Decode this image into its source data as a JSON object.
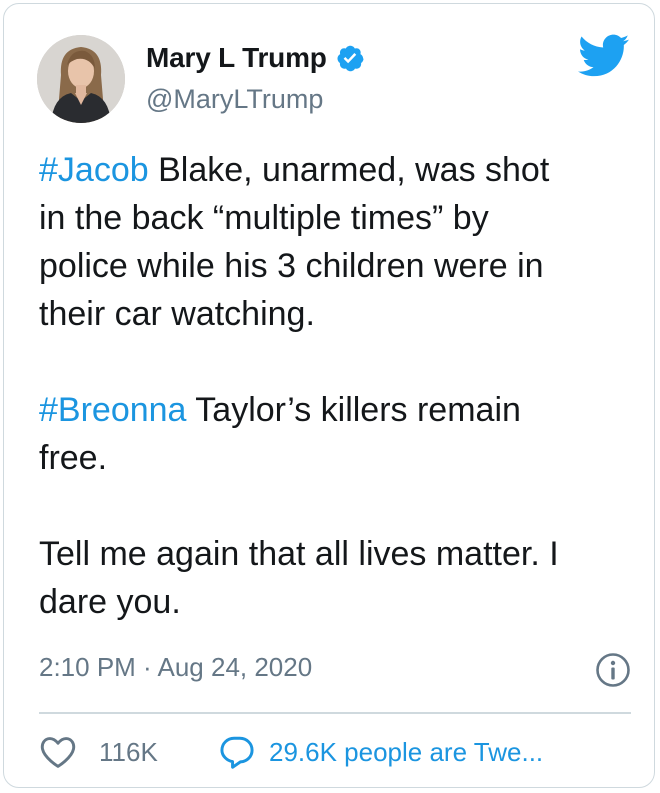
{
  "user": {
    "display_name": "Mary L Trump",
    "handle": "@MaryLTrump",
    "verified": true
  },
  "tweet": {
    "paragraphs": [
      {
        "lines": [
          [
            {
              "text": "#Jacob",
              "hashtag": true
            },
            {
              "text": " Blake, unarmed, was shot"
            }
          ],
          [
            {
              "text": "in the back “multiple times” by"
            }
          ],
          [
            {
              "text": "police while his 3 children were in"
            }
          ],
          [
            {
              "text": "their car watching."
            }
          ]
        ]
      },
      {
        "lines": [
          [
            {
              "text": "#Breonna",
              "hashtag": true
            },
            {
              "text": " Taylor’s killers remain"
            }
          ],
          [
            {
              "text": "free."
            }
          ]
        ]
      },
      {
        "lines": [
          [
            {
              "text": "Tell me again that all lives matter. I"
            }
          ],
          [
            {
              "text": "dare you."
            }
          ]
        ]
      }
    ],
    "timestamp": "2:10 PM · Aug 24, 2020"
  },
  "actions": {
    "like_count": "116K",
    "retweet_label": "29.6K people are Twe..."
  },
  "icons": {
    "brand": "twitter-bird-icon",
    "verified": "verified-badge-icon",
    "info": "info-icon",
    "like": "heart-icon",
    "retweet": "speech-bubble-icon"
  },
  "colors": {
    "accent": "#1b95e0",
    "text": "#14171a",
    "secondary": "#657786",
    "border": "#cfd9de"
  }
}
